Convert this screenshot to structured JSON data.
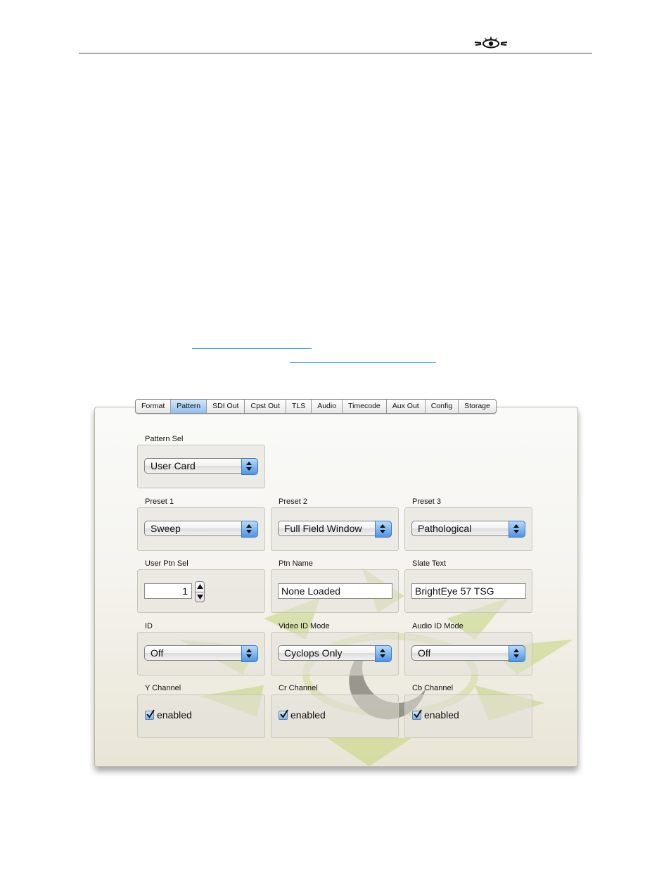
{
  "tabs": [
    {
      "label": "Format",
      "active": false
    },
    {
      "label": "Pattern",
      "active": true
    },
    {
      "label": "SDI Out",
      "active": false
    },
    {
      "label": "Cpst Out",
      "active": false
    },
    {
      "label": "TLS",
      "active": false
    },
    {
      "label": "Audio",
      "active": false
    },
    {
      "label": "Timecode",
      "active": false
    },
    {
      "label": "Aux Out",
      "active": false
    },
    {
      "label": "Config",
      "active": false
    },
    {
      "label": "Storage",
      "active": false
    }
  ],
  "pattern_sel": {
    "label": "Pattern Sel",
    "value": "User Card"
  },
  "preset1": {
    "label": "Preset 1",
    "value": "Sweep"
  },
  "preset2": {
    "label": "Preset 2",
    "value": "Full Field Window"
  },
  "preset3": {
    "label": "Preset 3",
    "value": "Pathological"
  },
  "user_ptn_sel": {
    "label": "User Ptn Sel",
    "value": "1"
  },
  "ptn_name": {
    "label": "Ptn Name",
    "value": "None Loaded"
  },
  "slate_text": {
    "label": "Slate Text",
    "value": "BrightEye 57 TSG"
  },
  "id": {
    "label": "ID",
    "value": "Off"
  },
  "video_id_mode": {
    "label": "Video ID Mode",
    "value": "Cyclops Only"
  },
  "audio_id_mode": {
    "label": "Audio ID Mode",
    "value": "Off"
  },
  "y_channel": {
    "label": "Y Channel",
    "checkbox_label": "enabled",
    "checked": true
  },
  "cr_channel": {
    "label": "Cr Channel",
    "checkbox_label": "enabled",
    "checked": true
  },
  "cb_channel": {
    "label": "Cb Channel",
    "checkbox_label": "enabled",
    "checked": true
  },
  "colors": {
    "active_tab": "#8dc1f1",
    "link": "#1f8fd6",
    "watermark_green": "#b7cc6b",
    "popup_blue": "#4d95e3"
  },
  "icons": {
    "logo": "eye-logo-icon",
    "watermark": "eye-watermark-icon"
  }
}
